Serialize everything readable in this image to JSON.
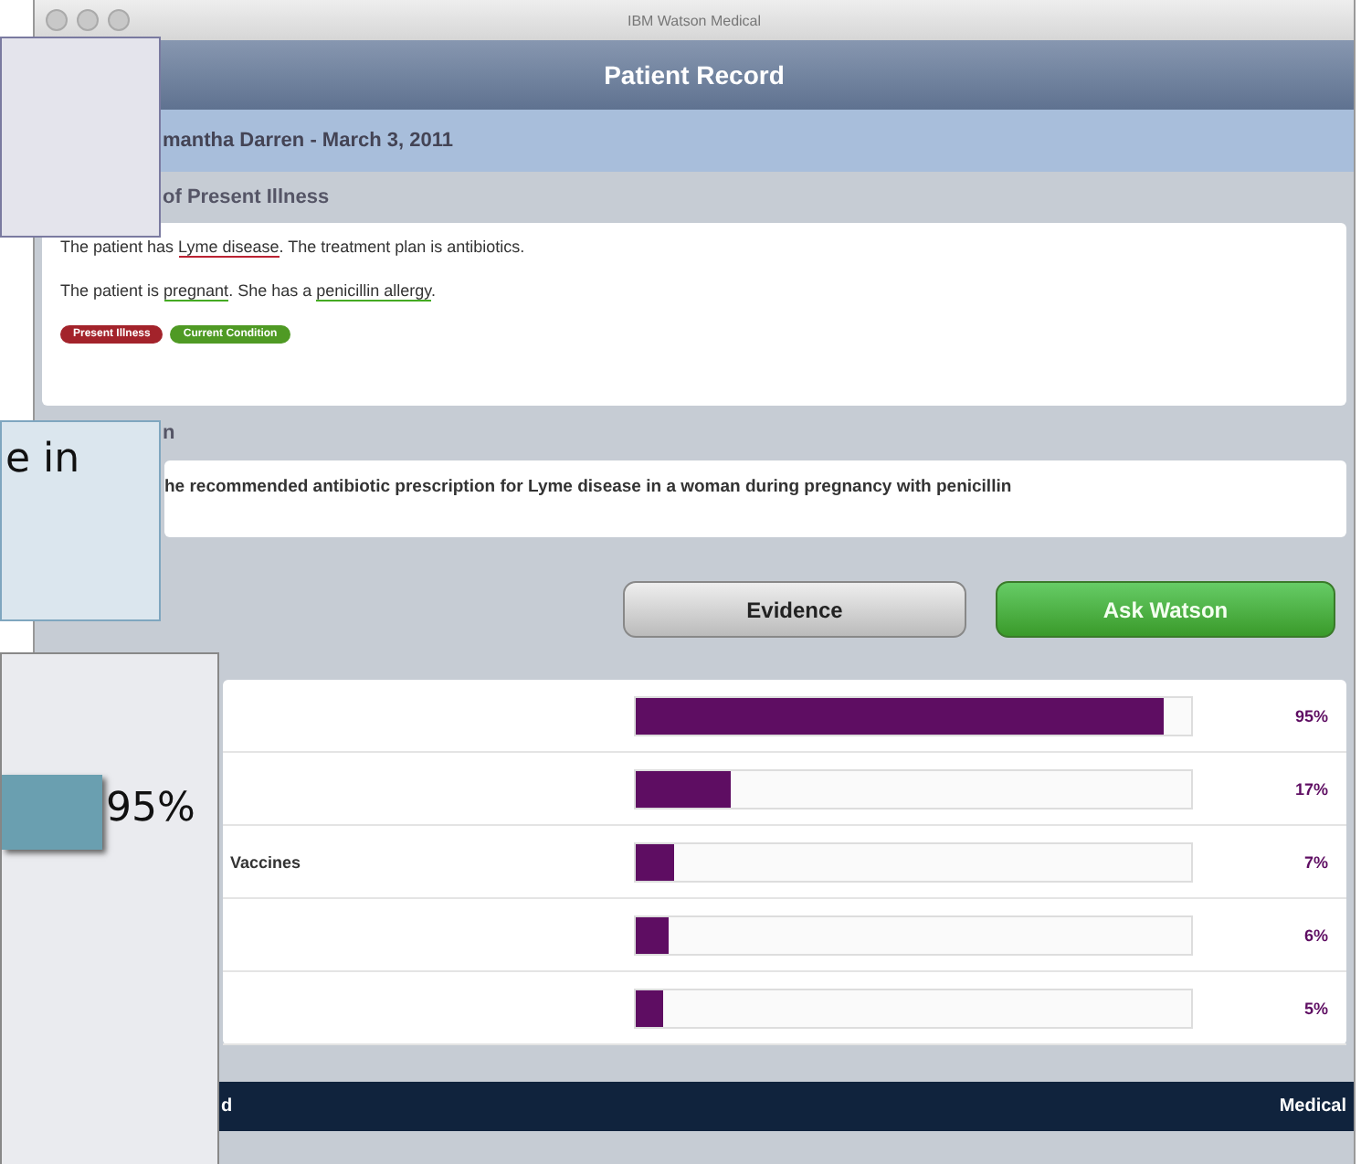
{
  "window": {
    "title": "IBM Watson Medical"
  },
  "header": {
    "title": "Patient Record"
  },
  "patient": {
    "name": "mantha Darren - March 3, 2011"
  },
  "illness": {
    "label": "of Present Illness",
    "sentences": [
      [
        {
          "text": "The patient has ",
          "kind": "plain"
        },
        {
          "text": "Lyme disease",
          "kind": "illness"
        },
        {
          "text": ". The treatment plan is antibiotics.",
          "kind": "plain"
        }
      ],
      [
        {
          "text": "The patient is ",
          "kind": "plain"
        },
        {
          "text": "pregnant",
          "kind": "condition"
        },
        {
          "text": ". She has a ",
          "kind": "plain"
        },
        {
          "text": "penicillin allergy",
          "kind": "condition"
        },
        {
          "text": ".",
          "kind": "plain"
        }
      ]
    ],
    "tags": [
      {
        "label": "Present Illness",
        "color": "#a3232b"
      },
      {
        "label": "Current Condition",
        "color": "#4f9a24"
      }
    ]
  },
  "question": {
    "label": "n",
    "text": "he recommended antibiotic prescription for Lyme disease in a woman during pregnancy with penicillin"
  },
  "buttons": [
    {
      "label": "Evidence",
      "kind": "secondary"
    },
    {
      "label": "Ask Watson",
      "kind": "primary"
    }
  ],
  "results": [
    {
      "level": 0.95,
      "reading": "95%"
    },
    {
      "level": 0.17,
      "reading": "17%"
    },
    {
      "label": "Vaccines",
      "level": 0.07,
      "reading": "7%"
    },
    {
      "level": 0.06,
      "reading": "6%"
    },
    {
      "level": 0.05,
      "reading": "5%"
    }
  ],
  "footer": {
    "left": "d",
    "right": "Medical"
  },
  "callouts": [
    {
      "kind": "plain"
    },
    {
      "kind": "text",
      "text": "e in"
    },
    {
      "kind": "meter",
      "text": "95%"
    }
  ]
}
